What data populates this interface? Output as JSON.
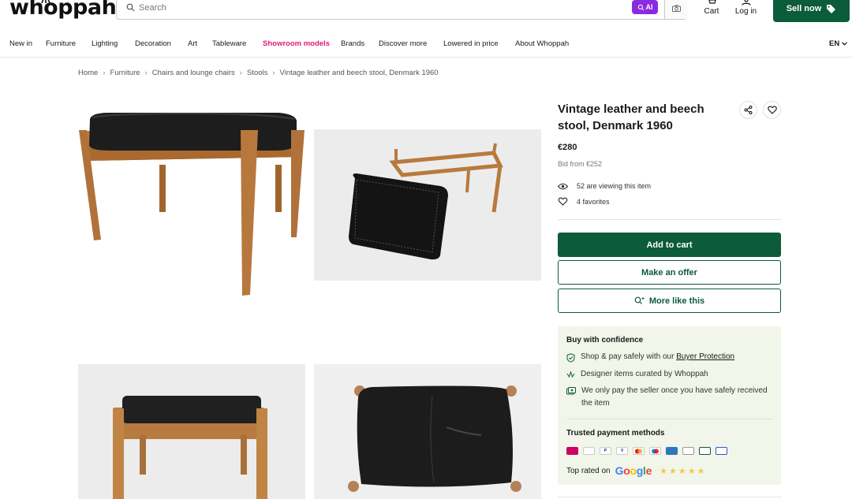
{
  "header": {
    "logo_text": "whoppah",
    "search_placeholder": "Search",
    "ai_label": "AI",
    "cart_label": "Cart",
    "login_label": "Log in",
    "sell_label": "Sell now"
  },
  "nav": {
    "items": [
      "New in",
      "Furniture",
      "Lighting",
      "Decoration",
      "Art",
      "Tableware",
      "Showroom models",
      "Brands",
      "Discover more",
      "Lowered in price",
      "About Whoppah"
    ],
    "highlight_index": 6,
    "language": "EN"
  },
  "breadcrumb": [
    "Home",
    "Furniture",
    "Chairs and lounge chairs",
    "Stools",
    "Vintage leather and beech stool, Denmark 1960"
  ],
  "product": {
    "title": "Vintage leather and beech stool, Denmark 1960",
    "price": "€280",
    "bid": "Bid from €252",
    "viewing": "52 are viewing this item",
    "favorites": "4 favorites",
    "add_to_cart": "Add to cart",
    "make_offer": "Make an offer",
    "more_like_this": "More like this"
  },
  "confidence": {
    "title": "Buy with confidence",
    "row1_text": "Shop & pay safely with our ",
    "row1_link": "Buyer Protection",
    "row2_text": "Designer items curated by Whoppah",
    "row3_text": "We only pay the seller once you have safely received the item",
    "payment_title": "Trusted payment methods",
    "top_rated_label": "Top rated on",
    "google_label": "Google",
    "rating_stars": 5
  },
  "colors": {
    "brand_green": "#0c5b3a",
    "highlight_pink": "#e0197d",
    "ai_purple": "#8a2be2",
    "confidence_bg": "#f1f5ea"
  }
}
